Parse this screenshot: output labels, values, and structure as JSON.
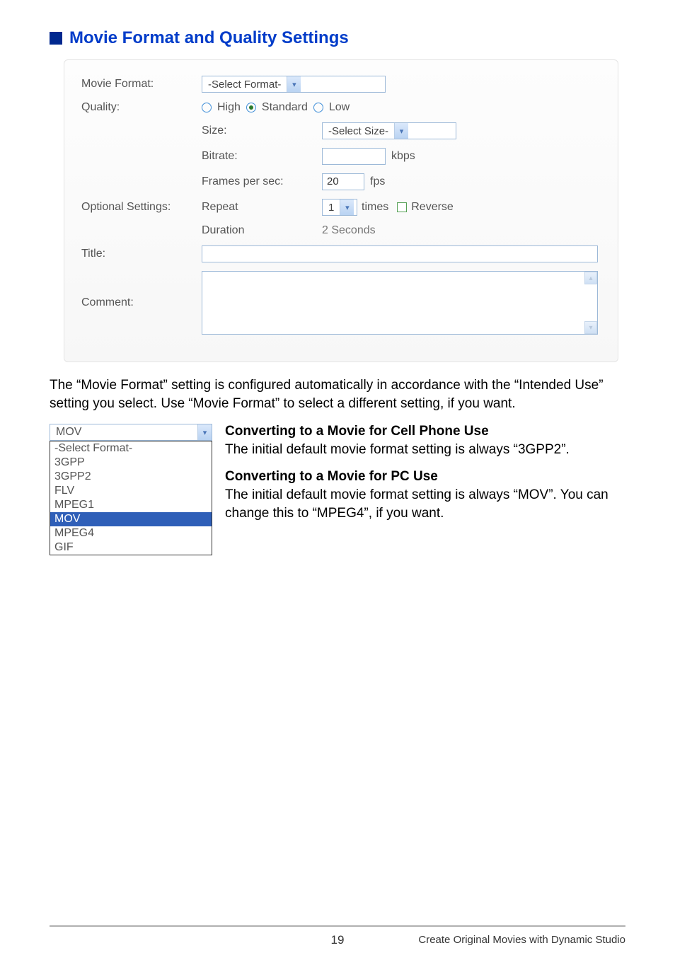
{
  "heading": "Movie Format and Quality Settings",
  "panel": {
    "movie_format_label": "Movie Format:",
    "movie_format_value": "-Select Format-",
    "quality_label": "Quality:",
    "quality_options": {
      "high": "High",
      "standard": "Standard",
      "low": "Low"
    },
    "size_label": "Size:",
    "size_value": "-Select Size-",
    "bitrate_label": "Bitrate:",
    "bitrate_value": "",
    "bitrate_unit": "kbps",
    "fps_label": "Frames per sec:",
    "fps_value": "20",
    "fps_unit": "fps",
    "optional_label": "Optional Settings:",
    "repeat_label": "Repeat",
    "repeat_value": "1",
    "times_label": "times",
    "reverse_label": "Reverse",
    "duration_label": "Duration",
    "duration_value": "2 Seconds",
    "title_label": "Title:",
    "comment_label": "Comment:"
  },
  "paragraph1": "The “Movie Format” setting is configured automatically in accordance with the “Intended Use” setting you select. Use “Movie Format” to select a different setting, if you want.",
  "dropdown": {
    "closed_value": "MOV",
    "options": [
      "-Select Format-",
      "3GPP",
      "3GPP2",
      "FLV",
      "MPEG1",
      "MOV",
      "MPEG4",
      "GIF"
    ],
    "selected": "MOV"
  },
  "section_cell": {
    "heading": "Converting to a Movie for Cell Phone Use",
    "body": "The initial default movie format setting is always “3GPP2”."
  },
  "section_pc": {
    "heading": "Converting to a Movie for PC Use",
    "body": "The initial default movie format setting is always “MOV”. You can change this to “MPEG4”, if you want."
  },
  "footer": {
    "page": "19",
    "right": "Create Original Movies with Dynamic Studio"
  }
}
